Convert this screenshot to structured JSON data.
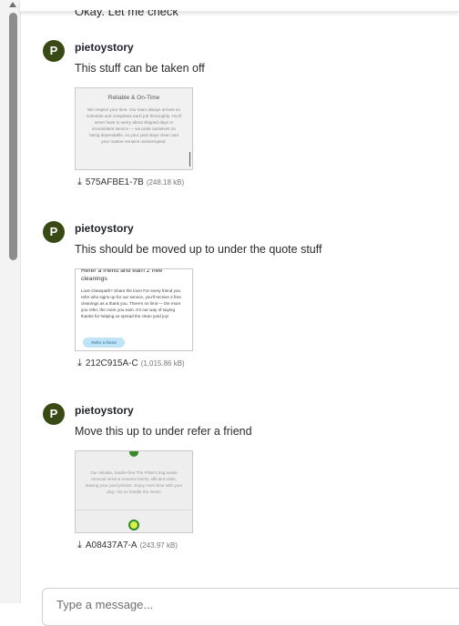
{
  "previous_message": "Okay. Let me check",
  "messages": [
    {
      "avatar_letter": "P",
      "author": "pietoystory",
      "text": "This stuff can be taken off",
      "attachment": {
        "filename": "575AFBE1-7B",
        "size": "(248.18 kB)",
        "preview": {
          "heading": "Reliable & On-Time",
          "body": "We respect your time. Our team always arrives on schedule and completes each job thoroughly. You'll never have to worry about skipped days or inconsistent service — we pride ourselves on being dependable, so your yard stays clean and your routine remains uninterrupted."
        }
      }
    },
    {
      "avatar_letter": "P",
      "author": "pietoystory",
      "text": "This should be moved up to under the quote stuff",
      "attachment": {
        "filename": "212C915A-C",
        "size": "(1,015.86 kB)",
        "preview": {
          "heading": "Refer a friend and earn 2 free cleanings",
          "body": "Love Cleanpath? Share the love! For every friend you refer who signs up for our service, you'll receive 2 free cleanings as a thank you. There's no limit — the more you refer, the more you earn. It's our way of saying thanks for helping us spread the clean yard joy!",
          "button": "Refer a friend"
        }
      }
    },
    {
      "avatar_letter": "P",
      "author": "pietoystory",
      "text": "Move this up to under refer a friend",
      "attachment": {
        "filename": "A08437A7-A",
        "size": "(243.97 kB)",
        "preview": {
          "body": "Our reliable, hassle-free The PNW's dog waste removal service ensures timely, efficient visits, leaving your yard pristine. Enjoy more time with your dog—let us handle the mess!"
        }
      }
    }
  ],
  "composer": {
    "placeholder": "Type a message..."
  },
  "colors": {
    "avatar_bg": "#3a4a14",
    "scroll_thumb": "#8d8d8d"
  }
}
